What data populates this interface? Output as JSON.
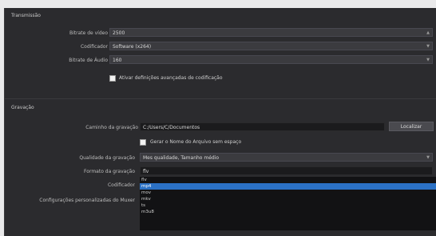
{
  "sections": {
    "streaming": "Transmissão",
    "recording": "Gravação"
  },
  "streaming": {
    "bitrate_label": "Bitrate de vídeo",
    "bitrate_value": "2500",
    "encoder_label": "Codificador",
    "encoder_value": "Software (x264)",
    "audio_bitrate_label": "Bitrate de Áudio",
    "audio_bitrate_value": "160",
    "advanced_label": "Ativar definições avançadas de codificação"
  },
  "recording": {
    "path_label": "Caminho da gravação",
    "path_value": "C:/Users/C/Documentos",
    "browse_label": "Localizar",
    "no_space_label": "Gerar o Nome do Arquivo sem espaço",
    "quality_label": "Qualidade da gravação",
    "quality_value": "Mes qualidade, Tamanho médio",
    "format_label": "Formato da gravação",
    "format_value": "flv",
    "encoder_label": "Codificador",
    "muxer_label": "Configurações personalizadas do Muxer",
    "format_options": [
      "flv",
      "mp4",
      "mov",
      "mkv",
      "ts",
      "m3u8"
    ],
    "selected_index": 1
  }
}
